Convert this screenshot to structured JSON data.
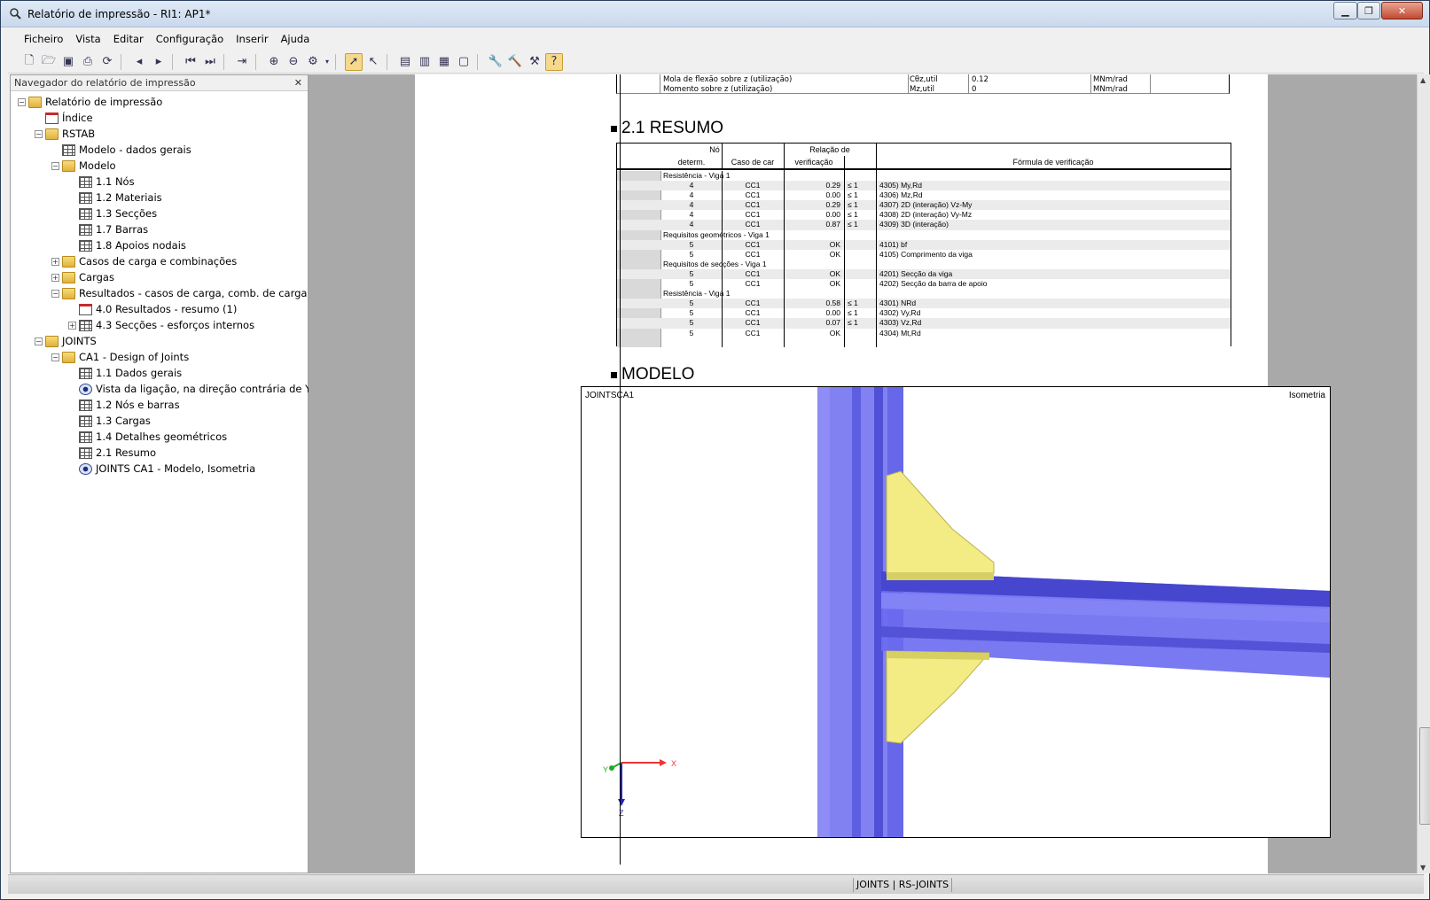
{
  "window": {
    "title": "Relatório de impressão - RI1: AP1*"
  },
  "menu": [
    "Ficheiro",
    "Vista",
    "Editar",
    "Configuração",
    "Inserir",
    "Ajuda"
  ],
  "navigator": {
    "title": "Navegador do relatório de impressão",
    "close": "✕",
    "tree": [
      {
        "label": "Relatório de impressão",
        "icon": "folder",
        "level": 0,
        "expander": "−"
      },
      {
        "label": "Índice",
        "icon": "index",
        "level": 1,
        "expander": ""
      },
      {
        "label": "RSTAB",
        "icon": "folder",
        "level": 1,
        "expander": "−"
      },
      {
        "label": "Modelo - dados gerais",
        "icon": "table",
        "level": 2,
        "expander": ""
      },
      {
        "label": "Modelo",
        "icon": "folder",
        "level": 2,
        "expander": "−"
      },
      {
        "label": "1.1 Nós",
        "icon": "table",
        "level": 3,
        "expander": ""
      },
      {
        "label": "1.2 Materiais",
        "icon": "table",
        "level": 3,
        "expander": ""
      },
      {
        "label": "1.3 Secções",
        "icon": "table",
        "level": 3,
        "expander": ""
      },
      {
        "label": "1.7 Barras",
        "icon": "table",
        "level": 3,
        "expander": ""
      },
      {
        "label": "1.8 Apoios nodais",
        "icon": "table",
        "level": 3,
        "expander": ""
      },
      {
        "label": "Casos de carga e combinações",
        "icon": "folder",
        "level": 2,
        "expander": "+"
      },
      {
        "label": "Cargas",
        "icon": "folder",
        "level": 2,
        "expander": "+"
      },
      {
        "label": "Resultados - casos de carga, comb. de carga",
        "icon": "folder",
        "level": 2,
        "expander": "−"
      },
      {
        "label": "4.0 Resultados - resumo (1)",
        "icon": "index",
        "level": 3,
        "expander": ""
      },
      {
        "label": "4.3 Secções - esforços internos",
        "icon": "table",
        "level": 3,
        "expander": "+"
      },
      {
        "label": "JOINTS",
        "icon": "folder",
        "level": 1,
        "expander": "−"
      },
      {
        "label": "CA1 - Design of Joints",
        "icon": "folder",
        "level": 2,
        "expander": "−"
      },
      {
        "label": "1.1 Dados gerais",
        "icon": "table",
        "level": 3,
        "expander": ""
      },
      {
        "label": "Vista da ligação, na direção contrária de Y",
        "icon": "eye",
        "level": 3,
        "expander": ""
      },
      {
        "label": "1.2 Nós e barras",
        "icon": "table",
        "level": 3,
        "expander": ""
      },
      {
        "label": "1.3 Cargas",
        "icon": "table",
        "level": 3,
        "expander": ""
      },
      {
        "label": "1.4 Detalhes geométricos",
        "icon": "table",
        "level": 3,
        "expander": ""
      },
      {
        "label": "2.1 Resumo",
        "icon": "table",
        "level": 3,
        "expander": ""
      },
      {
        "label": "JOINTS CA1 - Modelo, Isometria",
        "icon": "eye",
        "level": 3,
        "expander": ""
      }
    ]
  },
  "document": {
    "top_rows": [
      {
        "desc": "Mola de flexão sobre z (utilização)",
        "sym": "Cθz,util",
        "val": "0.12",
        "unit": "MNm/rad"
      },
      {
        "desc": "Momento sobre z (utilização)",
        "sym": "Mz,util",
        "val": "0",
        "unit": "MNm/rad"
      }
    ],
    "section_resumo": "2.1 RESUMO",
    "resumo_headers": {
      "no_top": "Nó",
      "no_bottom": "determ.",
      "caso": "Caso de car",
      "rel_top": "Relação de",
      "rel_bottom": "verificação",
      "formula": "Fórmula de verificação"
    },
    "resumo_rows": [
      {
        "type": "group",
        "label": "Resistência - Viga 1"
      },
      {
        "type": "row",
        "no": "4",
        "lc": "CC1",
        "ratio": "0.29",
        "le": "≤ 1",
        "formula": "4305) My,Rd"
      },
      {
        "type": "row",
        "no": "4",
        "lc": "CC1",
        "ratio": "0.00",
        "le": "≤ 1",
        "formula": "4306) Mz,Rd"
      },
      {
        "type": "row",
        "no": "4",
        "lc": "CC1",
        "ratio": "0.29",
        "le": "≤ 1",
        "formula": "4307) 2D (interação) Vz-My"
      },
      {
        "type": "row",
        "no": "4",
        "lc": "CC1",
        "ratio": "0.00",
        "le": "≤ 1",
        "formula": "4308) 2D (interação) Vy-Mz"
      },
      {
        "type": "row",
        "no": "4",
        "lc": "CC1",
        "ratio": "0.87",
        "le": "≤ 1",
        "formula": "4309) 3D (interação)"
      },
      {
        "type": "group",
        "label": "Requisitos geométricos - Viga 1"
      },
      {
        "type": "row",
        "no": "5",
        "lc": "CC1",
        "ratio": "OK",
        "le": "",
        "formula": "4101) bf"
      },
      {
        "type": "row",
        "no": "5",
        "lc": "CC1",
        "ratio": "OK",
        "le": "",
        "formula": "4105) Comprimento da viga"
      },
      {
        "type": "group",
        "label": "Requisitos de secções - Viga 1"
      },
      {
        "type": "row",
        "no": "5",
        "lc": "CC1",
        "ratio": "OK",
        "le": "",
        "formula": "4201) Secção da viga"
      },
      {
        "type": "row",
        "no": "5",
        "lc": "CC1",
        "ratio": "OK",
        "le": "",
        "formula": "4202) Secção da barra de apoio"
      },
      {
        "type": "group",
        "label": "Resistência - Viga 1"
      },
      {
        "type": "row",
        "no": "5",
        "lc": "CC1",
        "ratio": "0.58",
        "le": "≤ 1",
        "formula": "4301) NRd"
      },
      {
        "type": "row",
        "no": "5",
        "lc": "CC1",
        "ratio": "0.00",
        "le": "≤ 1",
        "formula": "4302) Vy,Rd"
      },
      {
        "type": "row",
        "no": "5",
        "lc": "CC1",
        "ratio": "0.07",
        "le": "≤ 1",
        "formula": "4303) Vz,Rd"
      },
      {
        "type": "row",
        "no": "5",
        "lc": "CC1",
        "ratio": "OK",
        "le": "",
        "formula": "4304) Mt,Rd"
      }
    ],
    "section_modelo": "MODELO",
    "model_label_left": "JOINTSCA1",
    "model_label_right": "Isometria",
    "axes": {
      "x": "X",
      "y": "Y",
      "z": "Z"
    }
  },
  "status": {
    "text": "JOINTS | RS-JOINTS"
  },
  "colors": {
    "beam": "#6f6ff2",
    "plate": "#f5ee8c",
    "accent": "#f6d98a"
  }
}
